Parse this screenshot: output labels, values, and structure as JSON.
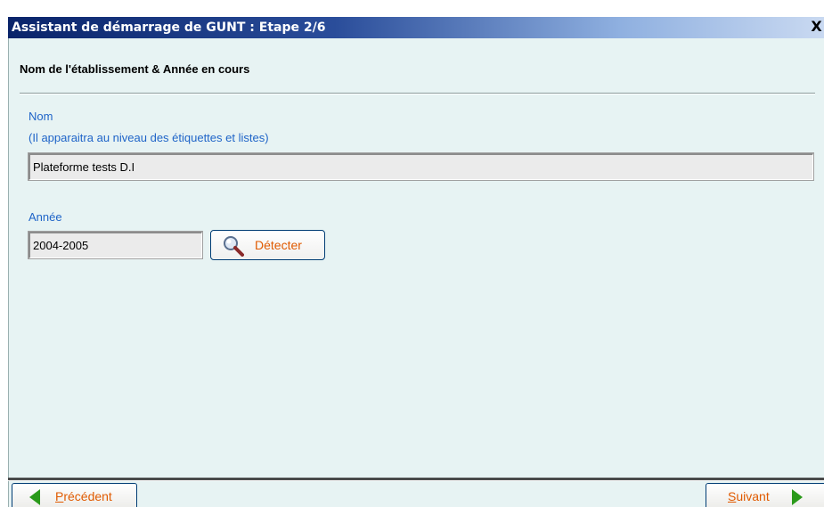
{
  "window": {
    "title": "Assistant de démarrage de GUNT : Etape 2/6",
    "close_label": "X"
  },
  "section": {
    "heading": "Nom de l'établissement & Année en cours"
  },
  "name_field": {
    "label": "Nom",
    "hint": "(Il apparaitra au  niveau des étiquettes et listes)",
    "value": "Plateforme tests D.I"
  },
  "year_field": {
    "label": "Année",
    "value": "2004-2005"
  },
  "detect_button": {
    "label": "Détecter",
    "icon": "magnifier-icon"
  },
  "navigation": {
    "previous_label": "Précédent",
    "previous_mnemonic": "P",
    "previous_rest": "récédent",
    "next_label": "Suivant",
    "next_mnemonic": "S",
    "next_rest": "uivant",
    "previous_icon": "arrow-left-icon",
    "next_icon": "arrow-right-icon"
  },
  "colors": {
    "title_start": "#0a246a",
    "title_end": "#c9d9f1",
    "background": "#e7f3f3",
    "label_blue": "#1f64c8",
    "button_text_orange": "#e05a00",
    "arrow_green": "#2a9a1a"
  }
}
